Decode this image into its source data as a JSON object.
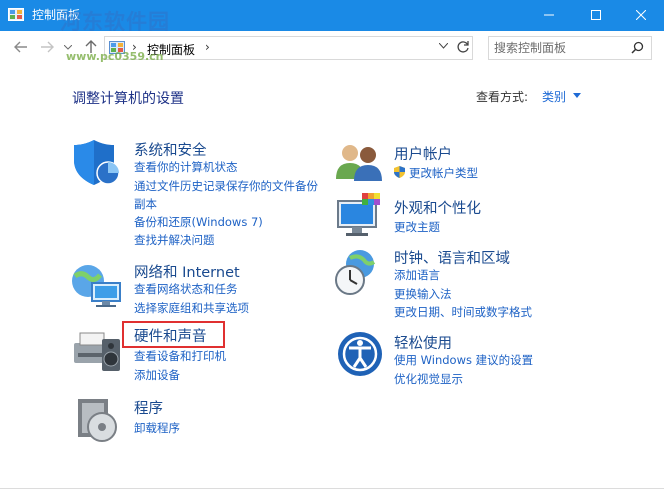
{
  "window": {
    "title": "控制面板",
    "watermark": "河东软件园",
    "watermark_url": "www.pc0359.cn"
  },
  "address": {
    "breadcrumb": "控制面板",
    "search_placeholder": "搜索控制面板"
  },
  "main": {
    "heading": "调整计算机的设置",
    "view_by_label": "查看方式:",
    "view_by_value": "类别"
  },
  "categories": [
    {
      "id": "system-security",
      "title": "系统和安全",
      "links": [
        "查看你的计算机状态",
        "通过文件历史记录保存你的文件备份",
        "副本",
        "备份和还原(Windows 7)",
        "查找并解决问题"
      ]
    },
    {
      "id": "network",
      "title": "网络和 Internet",
      "links": [
        "查看网络状态和任务",
        "选择家庭组和共享选项"
      ]
    },
    {
      "id": "hardware",
      "title": "硬件和声音",
      "links": [
        "查看设备和打印机",
        "添加设备"
      ]
    },
    {
      "id": "programs",
      "title": "程序",
      "links": [
        "卸载程序"
      ]
    },
    {
      "id": "user-accounts",
      "title": "用户帐户",
      "links": [
        "更改帐户类型"
      ]
    },
    {
      "id": "appearance",
      "title": "外观和个性化",
      "links": [
        "更改主题"
      ]
    },
    {
      "id": "clock-region",
      "title": "时钟、语言和区域",
      "links": [
        "添加语言",
        "更换输入法",
        "更改日期、时间或数字格式"
      ]
    },
    {
      "id": "ease",
      "title": "轻松使用",
      "links": [
        "使用 Windows 建议的设置",
        "优化视觉显示"
      ]
    }
  ],
  "colors": {
    "titlebar": "#1a8ae6",
    "heading": "#1e3287",
    "category_title": "#1a4a8f",
    "link": "#1e62c5",
    "highlight": "#e03030"
  }
}
